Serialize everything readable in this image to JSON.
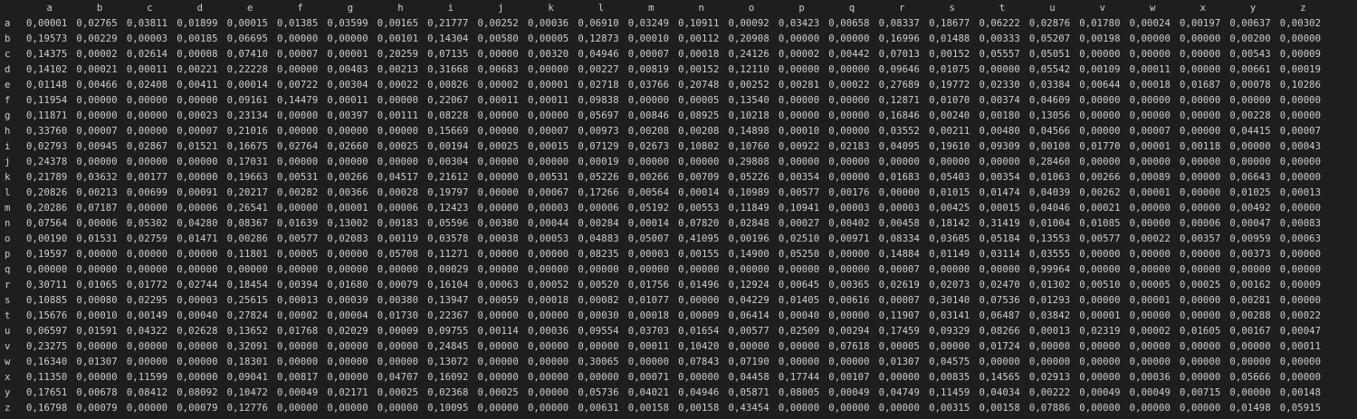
{
  "table": {
    "columns": [
      "a",
      "b",
      "c",
      "d",
      "e",
      "f",
      "g",
      "h",
      "i",
      "j",
      "k",
      "l",
      "m",
      "n",
      "o",
      "p",
      "q",
      "r",
      "s",
      "t",
      "u",
      "v",
      "w",
      "x",
      "y",
      "z"
    ],
    "rows": [
      {
        "label": "a",
        "values": [
          "0,00001",
          "0,02765",
          "0,03811",
          "0,01899",
          "0,00015",
          "0,01385",
          "0,03599",
          "0,00165",
          "0,21777",
          "0,00252",
          "0,00036",
          "0,06910",
          "0,03249",
          "0,10911",
          "0,00092",
          "0,03423",
          "0,00658",
          "0,08337",
          "0,18677",
          "0,06222",
          "0,02876",
          "0,01780",
          "0,00024",
          "0,00197",
          "0,00637",
          "0,00302"
        ]
      },
      {
        "label": "b",
        "values": [
          "0,19573",
          "0,00229",
          "0,00003",
          "0,00185",
          "0,06695",
          "0,00000",
          "0,00000",
          "0,00101",
          "0,14304",
          "0,00580",
          "0,00005",
          "0,12873",
          "0,00010",
          "0,00112",
          "0,20908",
          "0,00000",
          "0,00000",
          "0,16996",
          "0,01488",
          "0,00333",
          "0,05207",
          "0,00198",
          "0,00000",
          "0,00000",
          "0,00200",
          "0,00000"
        ]
      },
      {
        "label": "c",
        "values": [
          "0,14375",
          "0,00002",
          "0,02614",
          "0,00008",
          "0,07410",
          "0,00007",
          "0,00001",
          "0,20259",
          "0,07135",
          "0,00000",
          "0,00320",
          "0,04946",
          "0,00007",
          "0,00018",
          "0,24126",
          "0,00002",
          "0,00442",
          "0,07013",
          "0,00152",
          "0,05557",
          "0,05051",
          "0,00000",
          "0,00000",
          "0,00000",
          "0,00543",
          "0,00009"
        ]
      },
      {
        "label": "d",
        "values": [
          "0,14102",
          "0,00021",
          "0,00011",
          "0,00221",
          "0,22228",
          "0,00000",
          "0,00483",
          "0,00213",
          "0,31668",
          "0,00683",
          "0,00000",
          "0,00227",
          "0,00819",
          "0,00152",
          "0,12110",
          "0,00000",
          "0,00000",
          "0,09646",
          "0,01075",
          "0,00000",
          "0,05542",
          "0,00109",
          "0,00011",
          "0,00000",
          "0,00661",
          "0,00019"
        ]
      },
      {
        "label": "e",
        "values": [
          "0,01148",
          "0,00466",
          "0,02408",
          "0,00411",
          "0,00014",
          "0,00722",
          "0,00304",
          "0,00022",
          "0,00826",
          "0,00002",
          "0,00001",
          "0,02718",
          "0,03766",
          "0,20748",
          "0,00252",
          "0,00281",
          "0,00022",
          "0,27689",
          "0,19772",
          "0,02330",
          "0,03384",
          "0,00644",
          "0,00018",
          "0,01687",
          "0,00078",
          "0,10286"
        ]
      },
      {
        "label": "f",
        "values": [
          "0,11954",
          "0,00000",
          "0,00000",
          "0,00000",
          "0,09161",
          "0,14479",
          "0,00011",
          "0,00000",
          "0,22067",
          "0,00011",
          "0,00011",
          "0,09838",
          "0,00000",
          "0,00005",
          "0,13540",
          "0,00000",
          "0,00000",
          "0,12871",
          "0,01070",
          "0,00374",
          "0,04609",
          "0,00000",
          "0,00000",
          "0,00000",
          "0,00000",
          "0,00000"
        ]
      },
      {
        "label": "g",
        "values": [
          "0,11871",
          "0,00000",
          "0,00000",
          "0,00023",
          "0,23134",
          "0,00000",
          "0,00397",
          "0,00111",
          "0,08228",
          "0,00000",
          "0,00000",
          "0,05697",
          "0,00846",
          "0,08925",
          "0,10218",
          "0,00000",
          "0,00000",
          "0,16846",
          "0,00240",
          "0,00180",
          "0,13056",
          "0,00000",
          "0,00000",
          "0,00000",
          "0,00228",
          "0,00000"
        ]
      },
      {
        "label": "h",
        "values": [
          "0,33760",
          "0,00007",
          "0,00000",
          "0,00007",
          "0,21016",
          "0,00000",
          "0,00000",
          "0,00000",
          "0,15669",
          "0,00000",
          "0,00007",
          "0,00973",
          "0,00208",
          "0,00208",
          "0,14898",
          "0,00010",
          "0,00000",
          "0,03552",
          "0,00211",
          "0,00480",
          "0,04566",
          "0,00000",
          "0,00007",
          "0,00000",
          "0,04415",
          "0,00007"
        ]
      },
      {
        "label": "i",
        "values": [
          "0,02793",
          "0,00945",
          "0,02867",
          "0,01521",
          "0,16675",
          "0,02764",
          "0,02660",
          "0,00025",
          "0,00194",
          "0,00025",
          "0,00015",
          "0,07129",
          "0,02673",
          "0,10802",
          "0,10760",
          "0,00922",
          "0,02183",
          "0,04095",
          "0,19610",
          "0,09309",
          "0,00100",
          "0,01770",
          "0,00001",
          "0,00118",
          "0,00000",
          "0,00043"
        ]
      },
      {
        "label": "j",
        "values": [
          "0,24378",
          "0,00000",
          "0,00000",
          "0,00000",
          "0,17031",
          "0,00000",
          "0,00000",
          "0,00000",
          "0,00304",
          "0,00000",
          "0,00000",
          "0,00019",
          "0,00000",
          "0,00000",
          "0,29808",
          "0,00000",
          "0,00000",
          "0,00000",
          "0,00000",
          "0,00000",
          "0,28460",
          "0,00000",
          "0,00000",
          "0,00000",
          "0,00000",
          "0,00000"
        ]
      },
      {
        "label": "k",
        "values": [
          "0,21789",
          "0,03632",
          "0,00177",
          "0,00000",
          "0,19663",
          "0,00531",
          "0,00266",
          "0,04517",
          "0,21612",
          "0,00000",
          "0,00531",
          "0,05226",
          "0,00266",
          "0,00709",
          "0,05226",
          "0,00354",
          "0,00000",
          "0,01683",
          "0,05403",
          "0,00354",
          "0,01063",
          "0,00266",
          "0,00089",
          "0,00000",
          "0,06643",
          "0,00000"
        ]
      },
      {
        "label": "l",
        "values": [
          "0,20826",
          "0,00213",
          "0,00699",
          "0,00091",
          "0,20217",
          "0,00282",
          "0,00366",
          "0,00028",
          "0,19797",
          "0,00000",
          "0,00067",
          "0,17266",
          "0,00564",
          "0,00014",
          "0,10989",
          "0,00577",
          "0,00176",
          "0,00000",
          "0,01015",
          "0,01474",
          "0,04039",
          "0,00262",
          "0,00001",
          "0,00000",
          "0,01025",
          "0,00013"
        ]
      },
      {
        "label": "m",
        "values": [
          "0,20286",
          "0,07187",
          "0,00000",
          "0,00006",
          "0,26541",
          "0,00000",
          "0,00001",
          "0,00006",
          "0,12423",
          "0,00000",
          "0,00003",
          "0,00006",
          "0,05192",
          "0,00553",
          "0,11849",
          "0,10941",
          "0,00003",
          "0,00003",
          "0,00425",
          "0,00015",
          "0,04046",
          "0,00021",
          "0,00000",
          "0,00000",
          "0,00492",
          "0,00000"
        ]
      },
      {
        "label": "n",
        "values": [
          "0,07564",
          "0,00006",
          "0,05302",
          "0,04280",
          "0,08367",
          "0,01639",
          "0,13002",
          "0,00183",
          "0,05596",
          "0,00380",
          "0,00044",
          "0,00284",
          "0,00014",
          "0,07820",
          "0,02848",
          "0,00027",
          "0,00402",
          "0,00458",
          "0,18142",
          "0,31419",
          "0,01004",
          "0,01085",
          "0,00000",
          "0,00006",
          "0,00047",
          "0,00083"
        ]
      },
      {
        "label": "o",
        "values": [
          "0,00190",
          "0,01531",
          "0,02759",
          "0,01471",
          "0,00286",
          "0,00577",
          "0,02083",
          "0,00119",
          "0,03578",
          "0,00038",
          "0,00053",
          "0,04883",
          "0,05007",
          "0,41095",
          "0,00196",
          "0,02510",
          "0,00971",
          "0,08334",
          "0,03605",
          "0,05184",
          "0,13553",
          "0,00577",
          "0,00022",
          "0,00357",
          "0,00959",
          "0,00063"
        ]
      },
      {
        "label": "p",
        "values": [
          "0,19597",
          "0,00000",
          "0,00000",
          "0,00000",
          "0,11801",
          "0,00005",
          "0,00000",
          "0,05708",
          "0,11271",
          "0,00000",
          "0,00000",
          "0,08235",
          "0,00003",
          "0,00155",
          "0,14900",
          "0,05250",
          "0,00000",
          "0,14884",
          "0,01149",
          "0,03114",
          "0,03555",
          "0,00000",
          "0,00000",
          "0,00000",
          "0,00373",
          "0,00000"
        ]
      },
      {
        "label": "q",
        "values": [
          "0,00000",
          "0,00000",
          "0,00000",
          "0,00000",
          "0,00000",
          "0,00000",
          "0,00000",
          "0,00000",
          "0,00029",
          "0,00000",
          "0,00000",
          "0,00000",
          "0,00000",
          "0,00000",
          "0,00000",
          "0,00000",
          "0,00000",
          "0,00007",
          "0,00000",
          "0,00000",
          "0,99964",
          "0,00000",
          "0,00000",
          "0,00000",
          "0,00000",
          "0,00000"
        ]
      },
      {
        "label": "r",
        "values": [
          "0,30711",
          "0,01065",
          "0,01772",
          "0,02744",
          "0,18454",
          "0,00394",
          "0,01680",
          "0,00079",
          "0,16104",
          "0,00063",
          "0,00052",
          "0,00520",
          "0,01756",
          "0,01496",
          "0,12924",
          "0,00645",
          "0,00365",
          "0,02619",
          "0,02073",
          "0,02470",
          "0,01302",
          "0,00510",
          "0,00005",
          "0,00025",
          "0,00162",
          "0,00009"
        ]
      },
      {
        "label": "s",
        "values": [
          "0,10885",
          "0,00080",
          "0,02295",
          "0,00003",
          "0,25615",
          "0,00013",
          "0,00039",
          "0,00380",
          "0,13947",
          "0,00059",
          "0,00018",
          "0,00082",
          "0,01077",
          "0,00000",
          "0,04229",
          "0,01405",
          "0,00616",
          "0,00007",
          "0,30140",
          "0,07536",
          "0,01293",
          "0,00000",
          "0,00001",
          "0,00000",
          "0,00281",
          "0,00000"
        ]
      },
      {
        "label": "t",
        "values": [
          "0,15676",
          "0,00010",
          "0,00149",
          "0,00040",
          "0,27824",
          "0,00002",
          "0,00004",
          "0,01730",
          "0,22367",
          "0,00000",
          "0,00000",
          "0,00030",
          "0,00018",
          "0,00009",
          "0,06414",
          "0,00040",
          "0,00000",
          "0,11907",
          "0,03141",
          "0,06487",
          "0,03842",
          "0,00001",
          "0,00000",
          "0,00000",
          "0,00288",
          "0,00022"
        ]
      },
      {
        "label": "u",
        "values": [
          "0,06597",
          "0,01591",
          "0,04322",
          "0,02628",
          "0,13652",
          "0,01768",
          "0,02029",
          "0,00009",
          "0,09755",
          "0,00114",
          "0,00036",
          "0,09554",
          "0,03703",
          "0,01654",
          "0,00577",
          "0,02509",
          "0,00294",
          "0,17459",
          "0,09329",
          "0,08266",
          "0,00013",
          "0,02319",
          "0,00002",
          "0,01605",
          "0,00167",
          "0,00047"
        ]
      },
      {
        "label": "v",
        "values": [
          "0,23275",
          "0,00000",
          "0,00000",
          "0,00000",
          "0,32091",
          "0,00000",
          "0,00000",
          "0,00000",
          "0,24845",
          "0,00000",
          "0,00000",
          "0,00000",
          "0,00011",
          "0,10420",
          "0,00000",
          "0,00000",
          "0,07618",
          "0,00005",
          "0,00000",
          "0,01724",
          "0,00000",
          "0,00000",
          "0,00000",
          "0,00000",
          "0,00000",
          "0,00011"
        ]
      },
      {
        "label": "w",
        "values": [
          "0,16340",
          "0,01307",
          "0,00000",
          "0,00000",
          "0,18301",
          "0,00000",
          "0,00000",
          "0,00000",
          "0,13072",
          "0,00000",
          "0,00000",
          "0,30065",
          "0,00000",
          "0,07843",
          "0,07190",
          "0,00000",
          "0,00000",
          "0,01307",
          "0,04575",
          "0,00000",
          "0,00000",
          "0,00000",
          "0,00000",
          "0,00000",
          "0,00000",
          "0,00000"
        ]
      },
      {
        "label": "x",
        "values": [
          "0,11350",
          "0,00000",
          "0,11599",
          "0,00000",
          "0,09041",
          "0,00817",
          "0,00000",
          "0,04707",
          "0,16092",
          "0,00000",
          "0,00000",
          "0,00000",
          "0,00071",
          "0,00000",
          "0,04458",
          "0,17744",
          "0,00107",
          "0,00000",
          "0,00835",
          "0,14565",
          "0,02913",
          "0,00000",
          "0,00036",
          "0,00000",
          "0,05666",
          "0,00000"
        ]
      },
      {
        "label": "y",
        "values": [
          "0,17651",
          "0,00678",
          "0,08412",
          "0,08092",
          "0,10472",
          "0,00049",
          "0,02171",
          "0,00025",
          "0,02368",
          "0,00025",
          "0,00000",
          "0,05736",
          "0,04021",
          "0,04946",
          "0,05871",
          "0,08005",
          "0,00049",
          "0,04749",
          "0,11459",
          "0,04034",
          "0,00222",
          "0,00049",
          "0,00049",
          "0,00715",
          "0,00000",
          "0,00148"
        ]
      },
      {
        "label": "z",
        "values": [
          "0,16798",
          "0,00079",
          "0,00000",
          "0,00079",
          "0,12776",
          "0,00000",
          "0,00000",
          "0,00000",
          "0,10095",
          "0,00000",
          "0,00000",
          "0,00631",
          "0,00158",
          "0,00158",
          "0,43454",
          "0,00000",
          "0,00000",
          "0,00000",
          "0,00315",
          "0,00158",
          "0,07886",
          "0,00000",
          "0,00000",
          "0,00000",
          "0,01498",
          "0,05915"
        ]
      }
    ]
  }
}
